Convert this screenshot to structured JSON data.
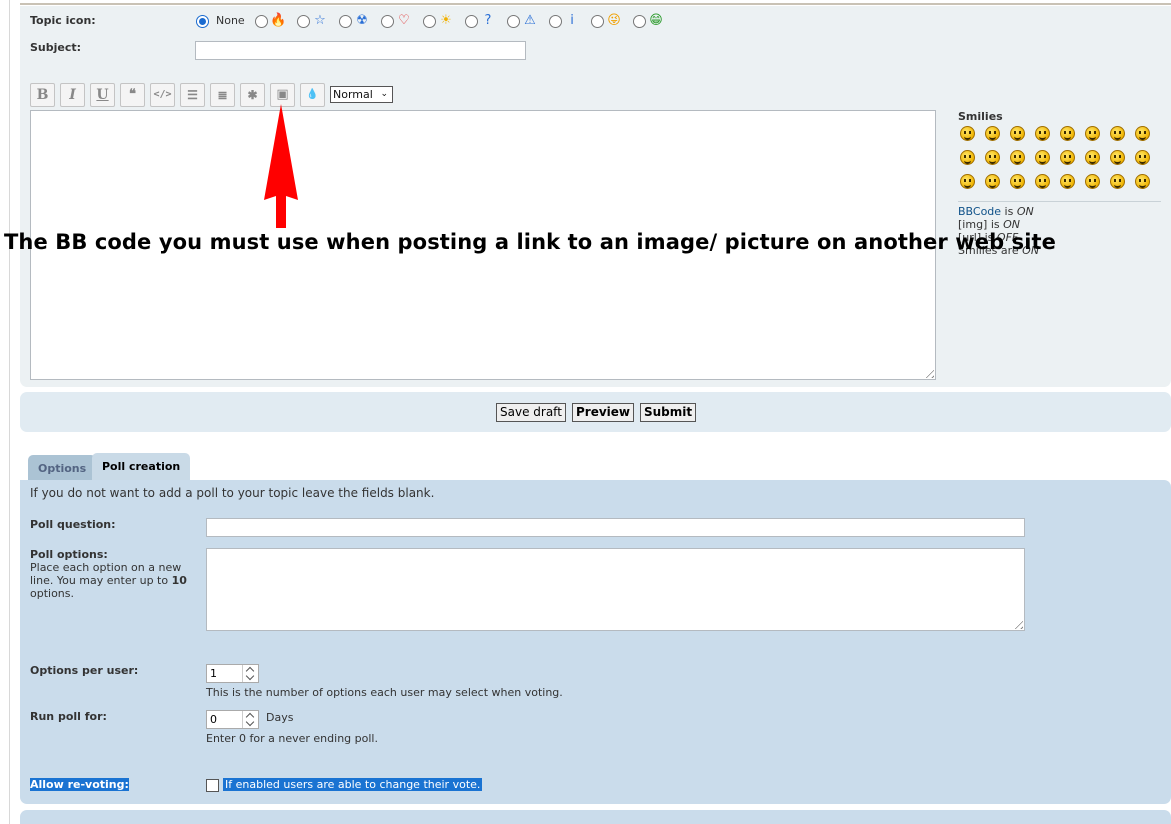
{
  "post": {
    "topic_icon_label": "Topic icon:",
    "topic_icon_none": "None",
    "topic_icons": [
      {
        "name": "fire-icon",
        "glyph": "🔥",
        "color": "#f0a030"
      },
      {
        "name": "star-icon",
        "glyph": "☆",
        "color": "#2a6fd6"
      },
      {
        "name": "radioactive-icon",
        "glyph": "☢",
        "color": "#2a6fd6"
      },
      {
        "name": "heart-icon",
        "glyph": "♡",
        "color": "#e02020"
      },
      {
        "name": "sun-icon",
        "glyph": "☀",
        "color": "#f0b000"
      },
      {
        "name": "question-icon",
        "glyph": "?",
        "color": "#2a6fd6"
      },
      {
        "name": "warning-icon",
        "glyph": "⚠",
        "color": "#2a6fd6"
      },
      {
        "name": "info-icon",
        "glyph": "i",
        "color": "#2a6fd6"
      },
      {
        "name": "smiley-wink-icon",
        "glyph": "😜",
        "color": "#f0a000"
      },
      {
        "name": "smiley-grin-icon",
        "glyph": "😁",
        "color": "#2a9a2a"
      }
    ],
    "subject_label": "Subject:",
    "subject_value": "",
    "toolbar": {
      "bold": "B",
      "italic": "I",
      "underline": "U",
      "quote": "❝",
      "code": "</>",
      "list": "☰",
      "list_numbered": "≣",
      "list_item": "✱",
      "image": "▣",
      "color": "💧",
      "font_size": "Normal"
    },
    "message_value": ""
  },
  "smilies": {
    "title": "Smilies",
    "count": 24,
    "bbcode_link": "BBCode",
    "bbcode_is": " is ",
    "bbcode_state": "ON",
    "img_label": "[img] is ",
    "img_state": "ON",
    "url_label": "[url] is ",
    "url_state": "OFF",
    "smilies_label": "Smilies are ",
    "smilies_state": "ON"
  },
  "annotation": {
    "text": "The BB code you must use when posting a link to an image/ picture on another web site",
    "arrow_color": "#ff0000"
  },
  "buttons": {
    "save_draft": "Save draft",
    "preview": "Preview",
    "submit": "Submit"
  },
  "tabs": {
    "options": "Options",
    "poll_creation": "Poll creation"
  },
  "poll": {
    "intro": "If you do not want to add a poll to your topic leave the fields blank.",
    "question_label": "Poll question:",
    "question_value": "",
    "options_label": "Poll options:",
    "options_help_1": "Place each option on a new",
    "options_help_2": "line. You may enter up to ",
    "options_help_max": "10",
    "options_help_3": "options.",
    "options_value": "",
    "per_user_label": "Options per user:",
    "per_user_value": "1",
    "per_user_help": "This is the number of options each user may select when voting.",
    "run_for_label": "Run poll for:",
    "run_for_value": "0",
    "run_for_unit": "Days",
    "run_for_help": "Enter 0 for a never ending poll.",
    "revote_label": "Allow re-voting:",
    "revote_help": "If enabled users are able to change their vote."
  }
}
